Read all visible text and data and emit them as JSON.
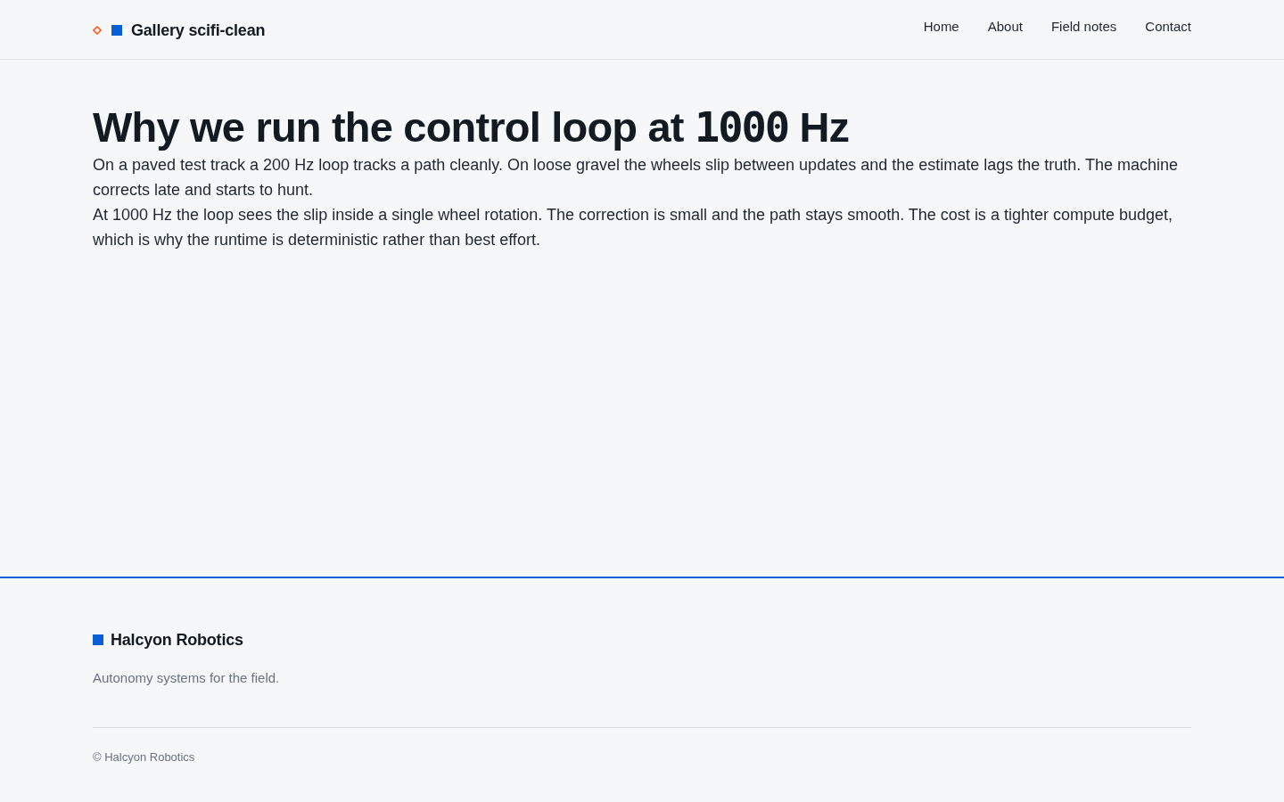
{
  "header": {
    "brand": "Gallery scifi-clean",
    "nav": [
      "Home",
      "About",
      "Field notes",
      "Contact"
    ]
  },
  "article": {
    "title_parts": [
      {
        "kind": "text",
        "text": "Why we run the control loop at "
      },
      {
        "kind": "mono",
        "text": "1000"
      },
      {
        "kind": "text",
        "text": " Hz"
      }
    ],
    "paragraphs": [
      "On a paved test track a 200 Hz loop tracks a path cleanly. On loose gravel the wheels slip between updates and the estimate lags the truth. The machine corrects late and starts to hunt.",
      "At 1000 Hz the loop sees the slip inside a single wheel rotation. The correction is small and the path stays smooth. The cost is a tighter compute budget, which is why the runtime is deterministic rather than best effort."
    ]
  },
  "footer": {
    "brand": "Halcyon Robotics",
    "tagline": "Autonomy systems for the field.",
    "copyright": "© Halcyon Robotics"
  }
}
